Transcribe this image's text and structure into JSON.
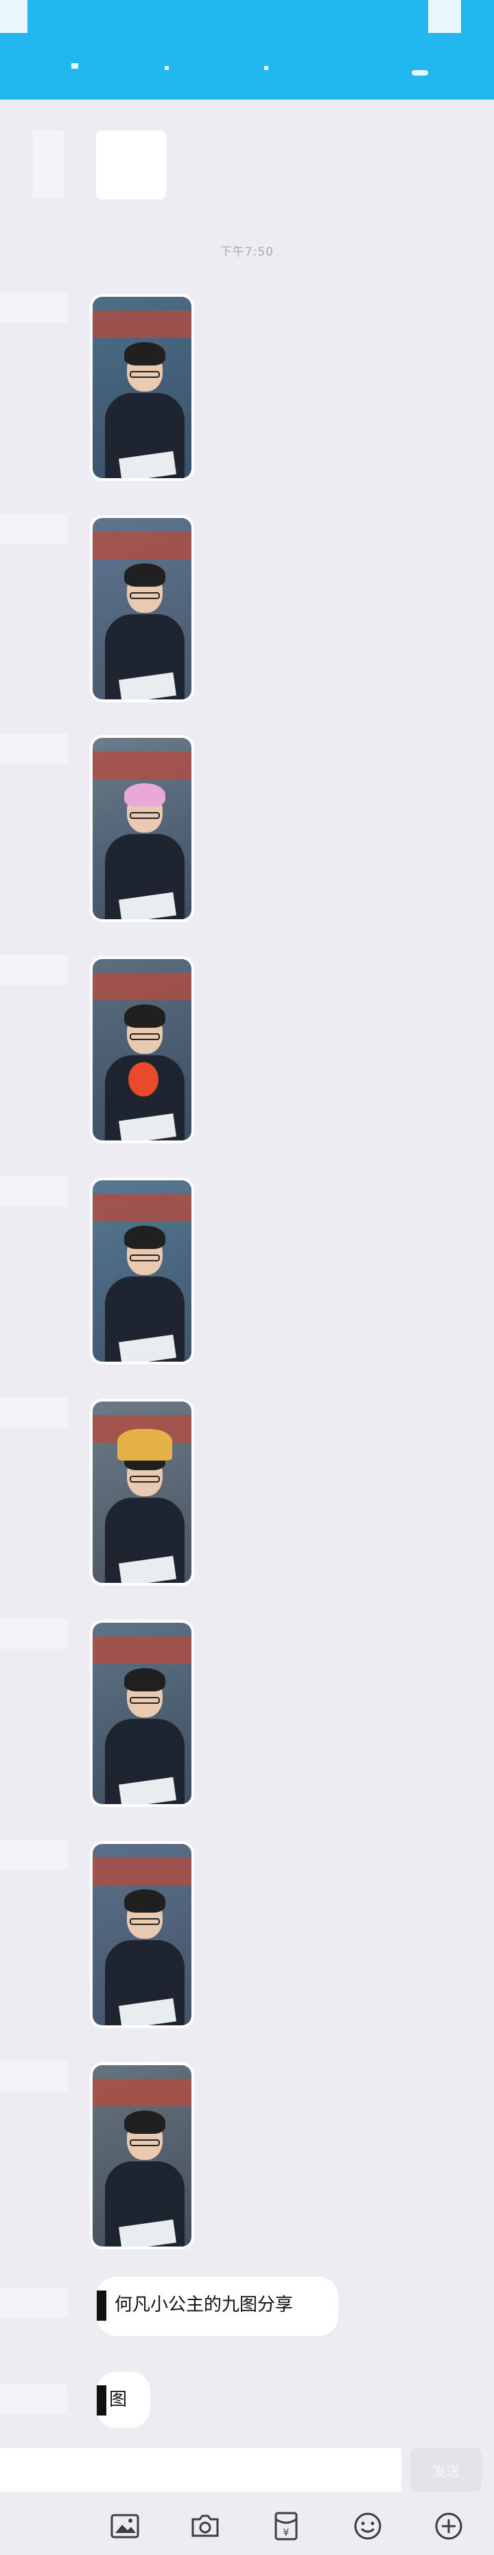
{
  "header": {
    "background_color": "#22b7ee"
  },
  "chat": {
    "timestamp": "下午7:50",
    "photos": [
      {
        "caption": "",
        "theme": "classroom-selfie-1"
      },
      {
        "caption": "",
        "theme": "classroom-selfie-2"
      },
      {
        "caption": "",
        "theme": "classroom-selfie-pink-hair"
      },
      {
        "caption": "",
        "theme": "classroom-selfie-sticker"
      },
      {
        "caption": "",
        "theme": "classroom-selfie-5"
      },
      {
        "caption": "",
        "theme": "classroom-selfie-crown"
      },
      {
        "caption": "",
        "theme": "classroom-selfie-7"
      },
      {
        "caption": "",
        "theme": "classroom-selfie-8"
      },
      {
        "caption": "",
        "theme": "classroom-selfie-9"
      }
    ],
    "messages": [
      {
        "text": "何凡小公主的九图分享"
      },
      {
        "text": "图"
      }
    ]
  },
  "input": {
    "placeholder": "",
    "send_label": "发送"
  },
  "toolbar": {
    "items": [
      {
        "icon": "image-icon"
      },
      {
        "icon": "camera-icon"
      },
      {
        "icon": "red-packet-icon"
      },
      {
        "icon": "emoji-icon"
      },
      {
        "icon": "plus-icon"
      }
    ]
  },
  "colors": {
    "accent": "#22b7ee",
    "chat_background": "#ececf2",
    "bubble": "#ffffff"
  }
}
